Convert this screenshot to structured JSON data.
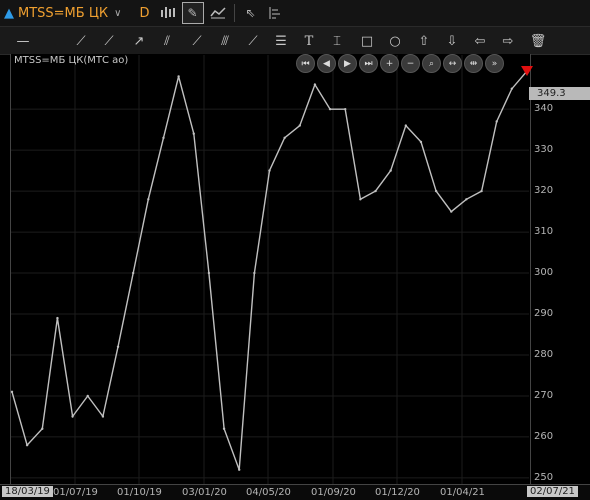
{
  "symbol": {
    "arrow_icon": "triangle-up-icon",
    "name": "MTSS=МБ ЦК",
    "period": "D"
  },
  "toolbar1_icons": [
    "candles-icon",
    "draw-icon",
    "indicator-icon",
    "cursor-icon",
    "layout-icon"
  ],
  "toolbar2_icons": [
    "hline-icon",
    "trendline-icon",
    "ray-icon",
    "arrow-line-icon",
    "channel-icon",
    "fork-icon",
    "fan-icon",
    "fibonacci-icon",
    "text-icon",
    "label-icon",
    "rectangle-icon",
    "ellipse-icon",
    "arrow-up-icon",
    "arrow-down-icon",
    "arrow-left-icon",
    "arrow-right-icon",
    "trash-icon"
  ],
  "chart": {
    "title": "MTSS=МБ ЦК(МТС ао)",
    "last_price": "349.3",
    "y_labels": [
      "340",
      "330",
      "320",
      "310",
      "300",
      "290",
      "280",
      "270",
      "260",
      "250"
    ],
    "x_labels": [
      "18/03/19",
      "01/07/19",
      "01/10/19",
      "03/01/20",
      "04/05/20",
      "01/09/20",
      "01/12/20",
      "01/04/21",
      "02/07/21"
    ],
    "nav_buttons": [
      "rewind-start-icon",
      "step-back-icon",
      "step-forward-icon",
      "fast-forward-icon",
      "zoom-in-icon",
      "zoom-out-icon",
      "zoom-fit-icon",
      "expand-icon",
      "compress-icon",
      "scroll-end-icon"
    ],
    "colors": {
      "price_line": "#c0c0c0",
      "grid": "#1c1c1c",
      "last_marker": "#e01010",
      "up_arrow": "#2e9be8",
      "symbol_text": "#f0a030"
    }
  },
  "chart_data": {
    "type": "line",
    "ylim": [
      249,
      352
    ],
    "x": [
      "18/03/19",
      "01/05/19",
      "01/06/19",
      "01/07/19",
      "15/07/19",
      "01/08/19",
      "01/09/19",
      "01/10/19",
      "01/11/19",
      "01/12/19",
      "03/01/20",
      "15/01/20",
      "01/02/20",
      "15/02/20",
      "01/03/20",
      "15/03/20",
      "01/04/20",
      "15/04/20",
      "04/05/20",
      "01/06/20",
      "01/07/20",
      "01/08/20",
      "01/09/20",
      "15/09/20",
      "01/10/20",
      "01/11/20",
      "01/12/20",
      "15/12/20",
      "01/01/21",
      "01/02/21",
      "01/03/21",
      "01/04/21",
      "01/05/21",
      "01/06/21",
      "02/07/21"
    ],
    "values": [
      271,
      258,
      262,
      289,
      265,
      270,
      265,
      282,
      300,
      318,
      333,
      348,
      334,
      300,
      262,
      252,
      300,
      325,
      333,
      336,
      346,
      340,
      340,
      318,
      320,
      325,
      336,
      332,
      320,
      315,
      318,
      320,
      337,
      345,
      349.3
    ]
  }
}
